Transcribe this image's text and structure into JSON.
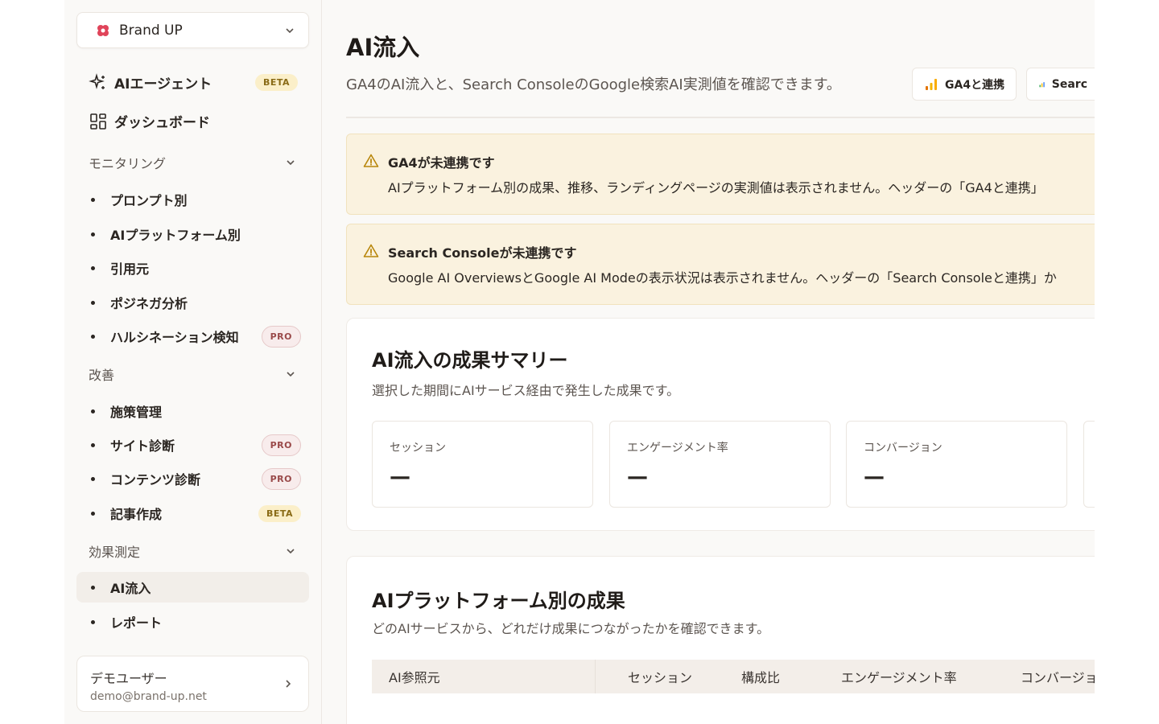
{
  "brand": {
    "name": "Brand UP"
  },
  "nav": {
    "agent": {
      "label": "AIエージェント",
      "badge": "BETA"
    },
    "dashboard": {
      "label": "ダッシュボード"
    }
  },
  "sections": {
    "monitoring": {
      "label": "モニタリング",
      "items": [
        {
          "label": "プロンプト別"
        },
        {
          "label": "AIプラットフォーム別"
        },
        {
          "label": "引用元"
        },
        {
          "label": "ポジネガ分析"
        },
        {
          "label": "ハルシネーション検知",
          "badge": "PRO"
        }
      ]
    },
    "improvement": {
      "label": "改善",
      "items": [
        {
          "label": "施策管理"
        },
        {
          "label": "サイト診断",
          "badge": "PRO"
        },
        {
          "label": "コンテンツ診断",
          "badge": "PRO"
        },
        {
          "label": "記事作成",
          "badge": "BETA"
        }
      ]
    },
    "measurement": {
      "label": "効果測定",
      "items": [
        {
          "label": "AI流入"
        },
        {
          "label": "レポート"
        }
      ]
    }
  },
  "user": {
    "name": "デモユーザー",
    "email": "demo@brand-up.net"
  },
  "page": {
    "title": "AI流入",
    "subtitle": "GA4のAI流入と、Search ConsoleのGoogle検索AI実測値を確認できます。",
    "buttons": {
      "ga4": "GA4と連携",
      "search_console": "Searc"
    }
  },
  "alerts": [
    {
      "title": "GA4が未連携です",
      "body": "AIプラットフォーム別の成果、推移、ランディングページの実測値は表示されません。ヘッダーの「GA4と連携」"
    },
    {
      "title": "Search Consoleが未連携です",
      "body": "Google AI OverviewsとGoogle AI Modeの表示状況は表示されません。ヘッダーの「Search Consoleと連携」か"
    }
  ],
  "summary": {
    "title": "AI流入の成果サマリー",
    "subtitle": "選択した期間にAIサービス経由で発生した成果です。",
    "metrics": [
      {
        "label": "セッション",
        "value": "—"
      },
      {
        "label": "エンゲージメント率",
        "value": "—"
      },
      {
        "label": "コンバージョン",
        "value": "—"
      }
    ]
  },
  "platform": {
    "title": "AIプラットフォーム別の成果",
    "subtitle": "どのAIサービスから、どれだけ成果につながったかを確認できます。",
    "columns": [
      "AI参照元",
      "セッション",
      "構成比",
      "エンゲージメント率",
      "コンバージョ"
    ]
  },
  "colors": {
    "accent_gold": "#f4b400",
    "google_blue": "#4285f4",
    "brand_red": "#e0445a"
  }
}
